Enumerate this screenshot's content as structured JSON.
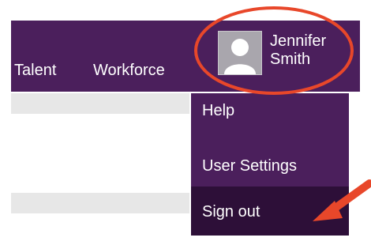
{
  "topbar": {
    "nav_items": [
      "Talent",
      "Workforce"
    ],
    "user": {
      "first_name": "Jennifer",
      "last_name": "Smith"
    }
  },
  "user_menu": {
    "items": [
      "Help",
      "User Settings",
      "Sign out"
    ],
    "highlighted_item": "Sign out"
  },
  "icons": {
    "avatar": "user-avatar-icon"
  },
  "annotation": {
    "color": "#e8472a",
    "shapes": [
      "ellipse around user profile",
      "arrow pointing to Sign out"
    ]
  },
  "colors": {
    "header_bg": "#4b1f5c",
    "menu_bg": "#4b1f5c",
    "highlight_bg": "#2d0f38",
    "text": "#ffffff",
    "accent_annotation": "#e8472a"
  }
}
